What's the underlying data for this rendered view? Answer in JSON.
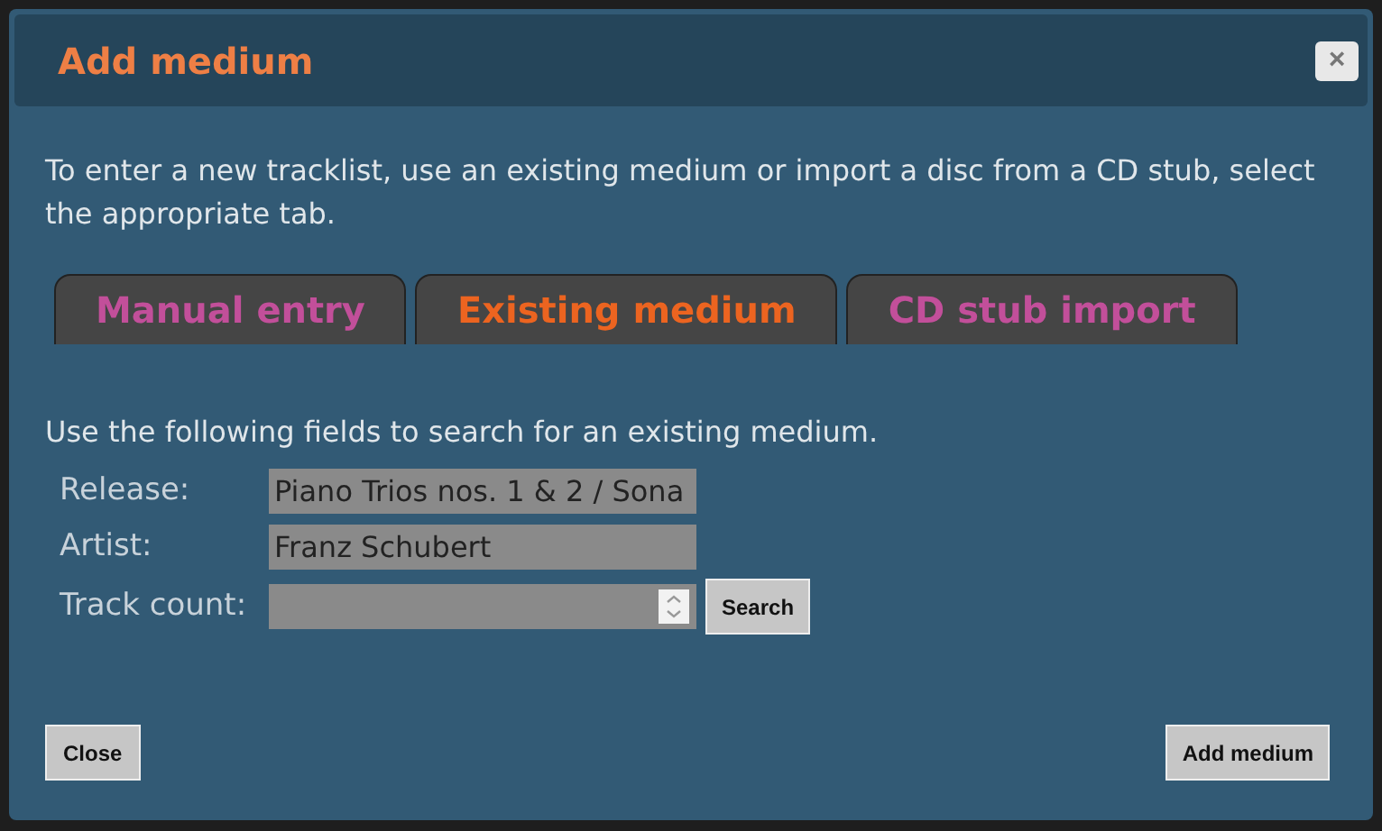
{
  "dialog": {
    "title": "Add medium",
    "close_icon": "×"
  },
  "intro": "To enter a new tracklist, use an existing medium or import a disc from a CD stub, select the appropriate tab.",
  "tabs": [
    {
      "label": "Manual entry",
      "selected": false
    },
    {
      "label": "Existing medium",
      "selected": true
    },
    {
      "label": "CD stub import",
      "selected": false
    }
  ],
  "instructions": "Use the following fields to search for an existing medium.",
  "fields": [
    {
      "kind": "text",
      "label": "Release:",
      "value": "Piano Trios nos. 1 & 2 / Sona"
    },
    {
      "kind": "text",
      "label": "Artist:",
      "value": "Franz Schubert"
    },
    {
      "kind": "number",
      "label": "Track count:"
    }
  ],
  "search_button": "Search",
  "buttons": {
    "close": "Close",
    "add": "Add medium"
  }
}
